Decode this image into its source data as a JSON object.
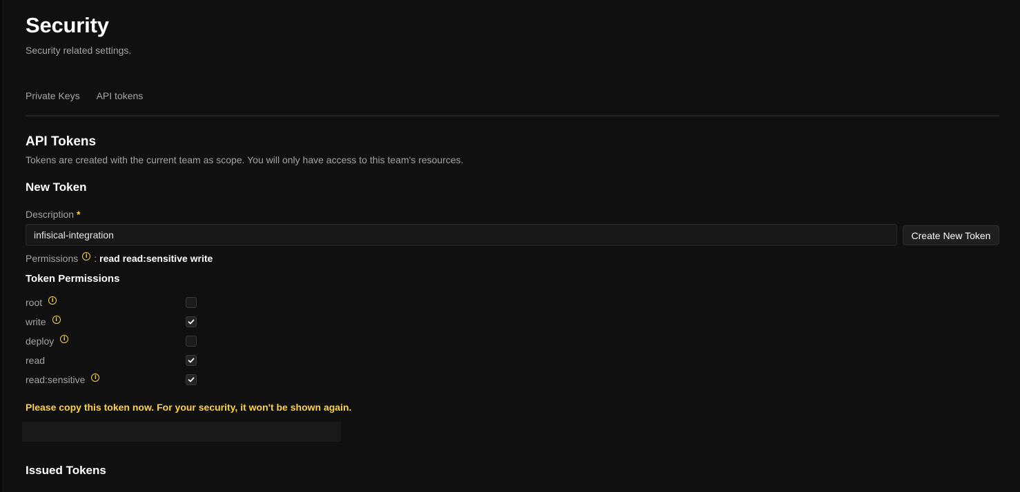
{
  "page": {
    "title": "Security",
    "subtitle": "Security related settings."
  },
  "tabs": [
    {
      "label": "Private Keys"
    },
    {
      "label": "API tokens"
    }
  ],
  "api_tokens": {
    "title": "API Tokens",
    "description": "Tokens are created with the current team as scope. You will only have access to this team's resources."
  },
  "new_token": {
    "title": "New Token",
    "description_label": "Description",
    "required_marker": "*",
    "description_value": "infisical-integration",
    "create_button_label": "Create New Token",
    "permissions_label": "Permissions",
    "permissions_separator": ":",
    "permissions_value": "read read:sensitive write"
  },
  "token_permissions": {
    "title": "Token Permissions",
    "items": [
      {
        "label": "root",
        "checked": false,
        "has_info": true
      },
      {
        "label": "write",
        "checked": true,
        "has_info": true
      },
      {
        "label": "deploy",
        "checked": false,
        "has_info": true
      },
      {
        "label": "read",
        "checked": true,
        "has_info": false
      },
      {
        "label": "read:sensitive",
        "checked": true,
        "has_info": true
      }
    ]
  },
  "copy_warning": "Please copy this token now. For your security, it won't be shown again.",
  "issued_tokens": {
    "title": "Issued Tokens"
  },
  "colors": {
    "background": "#101010",
    "accent_warning": "#fcd34d",
    "text_primary": "#ffffff",
    "text_muted": "#a3a3a3"
  }
}
